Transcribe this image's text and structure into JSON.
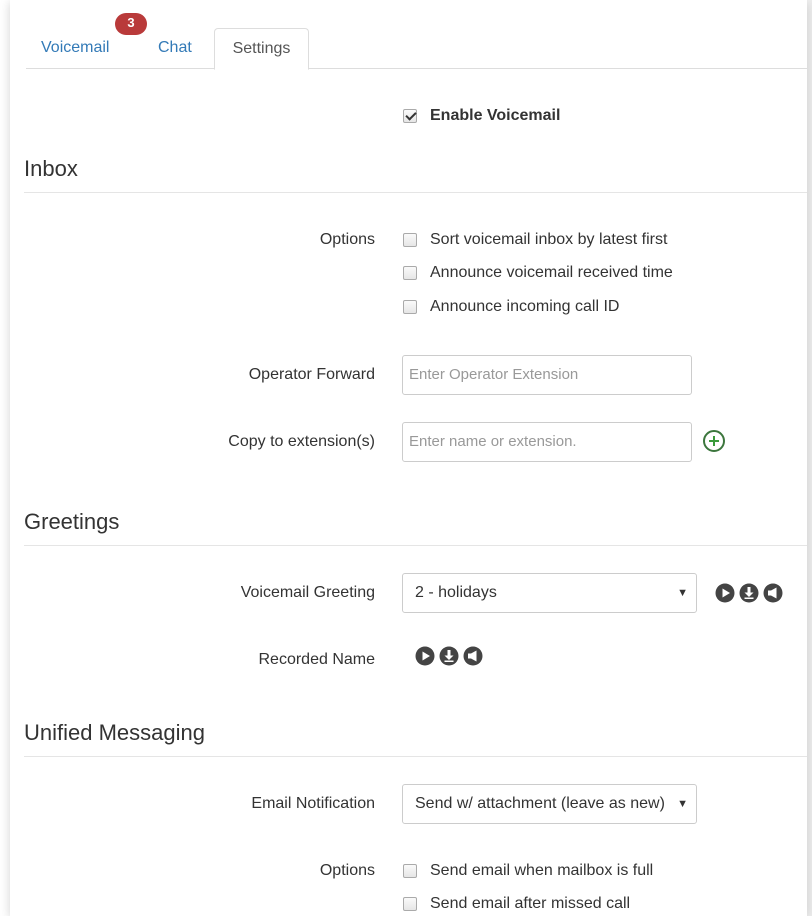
{
  "tabs": [
    {
      "label": "Voicemail",
      "badge": "3"
    },
    {
      "label": "Chat"
    },
    {
      "label": "Settings"
    }
  ],
  "enable_voicemail": {
    "label": "Enable Voicemail",
    "checked": true
  },
  "inbox": {
    "title": "Inbox",
    "options_label": "Options",
    "options": [
      {
        "label": "Sort voicemail inbox by latest first",
        "checked": false
      },
      {
        "label": "Announce voicemail received time",
        "checked": false
      },
      {
        "label": "Announce incoming call ID",
        "checked": false
      }
    ],
    "operator_forward_label": "Operator Forward",
    "operator_forward_placeholder": "Enter Operator Extension",
    "copy_to_label": "Copy to extension(s)",
    "copy_to_placeholder": "Enter name or extension."
  },
  "greetings": {
    "title": "Greetings",
    "voicemail_greeting_label": "Voicemail Greeting",
    "voicemail_greeting_value": "2 - holidays",
    "recorded_name_label": "Recorded Name",
    "icons": [
      "play-icon",
      "download-icon",
      "record-icon"
    ]
  },
  "unified_messaging": {
    "title": "Unified Messaging",
    "email_notification_label": "Email Notification",
    "email_notification_value": "Send w/ attachment (leave as new)",
    "options_label": "Options",
    "options": [
      {
        "label": "Send email when mailbox is full",
        "checked": false
      },
      {
        "label": "Send email after missed call",
        "checked": false
      }
    ]
  },
  "colors": {
    "link": "#337ab7",
    "badge": "#b93a3a",
    "add": "#3a9a3a"
  }
}
